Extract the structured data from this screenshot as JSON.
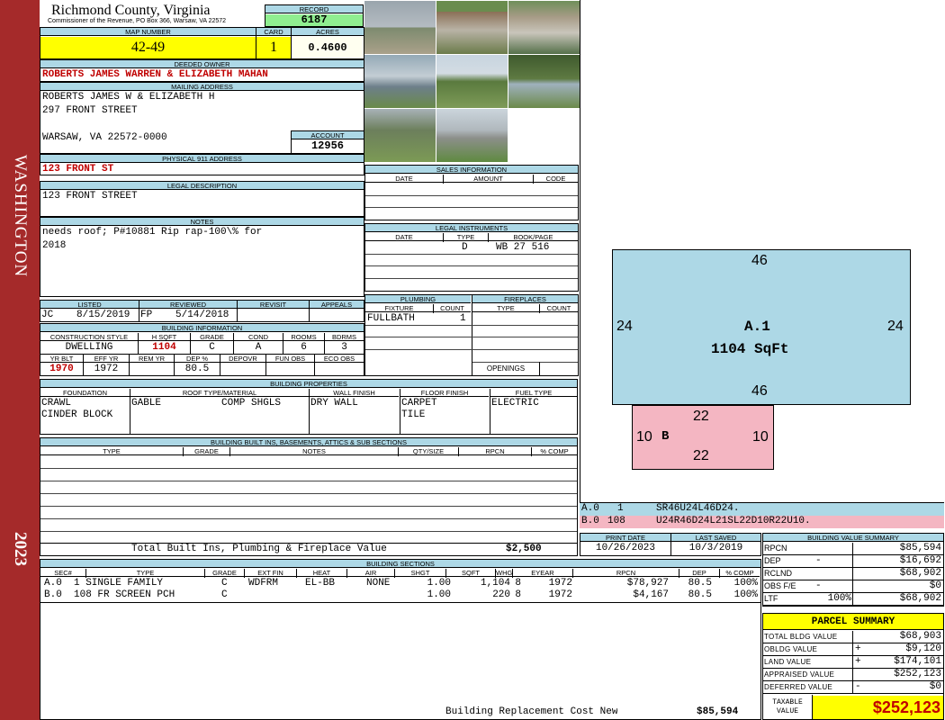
{
  "sidebar": {
    "district": "WASHINGTON",
    "year": "2023",
    "color": "#a52a2a"
  },
  "header": {
    "county": "Richmond County, Virginia",
    "commissioner": "Commissioner of the Revenue, PO Box 366, Warsaw, VA 22572"
  },
  "record": {
    "label": "RECORD",
    "value": "6187"
  },
  "map_number": {
    "label": "MAP NUMBER",
    "value": "42-49"
  },
  "card": {
    "label": "CARD",
    "value": "1"
  },
  "acres": {
    "label": "ACRES",
    "value": "0.4600"
  },
  "deeded_owner": {
    "label": "DEEDED OWNER",
    "value": "ROBERTS JAMES WARREN & ELIZABETH MAHAN"
  },
  "mailing": {
    "label": "MAILING ADDRESS",
    "line1": "ROBERTS JAMES W & ELIZABETH H",
    "line2": "297 FRONT STREET",
    "line3": "WARSAW, VA 22572-0000"
  },
  "account": {
    "label": "ACCOUNT",
    "value": "12956"
  },
  "physical": {
    "label": "PHYSICAL 911 ADDRESS",
    "value": "123 FRONT ST"
  },
  "legal": {
    "label": "LEGAL DESCRIPTION",
    "value": "123 FRONT STREET"
  },
  "notes": {
    "label": "NOTES",
    "line1": "needs roof; P#10881 Rip rap-100\\% for",
    "line2": "2018"
  },
  "sales": {
    "label": "SALES INFORMATION",
    "cols": [
      "DATE",
      "AMOUNT",
      "CODE"
    ]
  },
  "legal_instruments": {
    "label": "LEGAL INSTRUMENTS",
    "cols": [
      "DATE",
      "TYPE",
      "BOOK/PAGE"
    ],
    "row": {
      "type": "D",
      "book": "WB 27 516"
    }
  },
  "dates": {
    "listed_label": "LISTED",
    "reviewed_label": "REVIEWED",
    "revisit_label": "REVISIT",
    "appeals_label": "APPEALS",
    "listed_by": "JC",
    "listed": "8/15/2019",
    "reviewed_by": "FP",
    "reviewed": "5/14/2018"
  },
  "plumbing": {
    "label": "PLUMBING",
    "fixture_label": "FIXTURE",
    "count_label": "COUNT",
    "fixture": "FULLBATH",
    "count": "1"
  },
  "fireplaces": {
    "label": "FIREPLACES",
    "type_label": "TYPE",
    "count_label": "COUNT",
    "openings_label": "OPENINGS"
  },
  "building_info": {
    "label": "BUILDING INFORMATION",
    "cols1": [
      "CONSTRUCTION STYLE",
      "H SQFT",
      "GRADE",
      "COND",
      "ROOMS",
      "BDRMS"
    ],
    "vals1": [
      "DWELLING",
      "1104",
      "C",
      "A",
      "6",
      "3"
    ],
    "cols2": [
      "YR BLT",
      "EFF YR",
      "REM YR",
      "DEP %",
      "DEPOVR",
      "FUN OBS",
      "ECO OBS"
    ],
    "vals2": [
      "1970",
      "1972",
      "",
      "80.5",
      "",
      "",
      ""
    ]
  },
  "building_props": {
    "label": "BUILDING PROPERTIES",
    "cols": [
      "FOUNDATION",
      "ROOF TYPE/MATERIAL",
      "WALL FINISH",
      "FLOOR FINISH",
      "FUEL TYPE"
    ],
    "foundation": [
      "CRAWL",
      "CINDER BLOCK"
    ],
    "roof_type": "GABLE",
    "roof_material": "COMP SHGLS",
    "wall": "DRY WALL",
    "floor": [
      "CARPET",
      "TILE"
    ],
    "fuel": "ELECTRIC"
  },
  "built_ins": {
    "label": "BUILDING BUILT INS, BASEMENTS, ATTICS & SUB SECTIONS",
    "cols": [
      "TYPE",
      "GRADE",
      "NOTES",
      "QTY/SIZE",
      "RPCN",
      "% COMP"
    ],
    "total_label": "Total Built Ins, Plumbing & Fireplace Value",
    "total": "$2,500"
  },
  "print": {
    "print_label": "PRINT DATE",
    "saved_label": "LAST SAVED",
    "print_date": "10/26/2023",
    "last_saved": "10/3/2019"
  },
  "sketch": {
    "areaA": {
      "label": "A.1",
      "sqft": "1104 SqFt",
      "top": "46",
      "bottom": "46",
      "left": "24",
      "right": "24",
      "color": "#add8e6"
    },
    "areaB": {
      "label": "B",
      "top": "22",
      "bottom": "22",
      "left": "10",
      "right": "10",
      "color": "#f4b6c2"
    },
    "legendA": {
      "code": "A.0",
      "num": "1",
      "path": "SR46U24L46D24."
    },
    "legendB": {
      "code": "B.0",
      "num": "108",
      "path": "U24R46D24L21SL22D10R22U10."
    }
  },
  "sections": {
    "label": "BUILDING SECTIONS",
    "cols": [
      "SEC#",
      "TYPE",
      "GRADE",
      "EXT FIN",
      "HEAT",
      "AIR",
      "SHGT",
      "SQFT",
      "WHGT",
      "EYEAR",
      "RPCN",
      "DEP",
      "% COMP"
    ],
    "rows": [
      [
        "A.0",
        "1 SINGLE FAMILY",
        "C",
        "WDFRM",
        "EL-BB",
        "NONE",
        "1.00",
        "1,104",
        "8",
        "1972",
        "$78,927",
        "80.5",
        "100%"
      ],
      [
        "B.0",
        "108 FR SCREEN PCH",
        "C",
        "",
        "",
        "",
        "1.00",
        "220",
        "8",
        "1972",
        "$4,167",
        "80.5",
        "100%"
      ]
    ],
    "replacement_label": "Building Replacement Cost New",
    "replacement": "$85,594"
  },
  "value_summary": {
    "label": "BUILDING VALUE SUMMARY",
    "rows": [
      {
        "label": "RPCN",
        "sign": "",
        "value": "$85,594"
      },
      {
        "label": "DEP",
        "sign": "-",
        "value": "$16,692"
      },
      {
        "label": "RCLND",
        "sign": "",
        "value": "$68,902"
      },
      {
        "label": "OBS F/E",
        "sign": "-",
        "value": "$0"
      },
      {
        "label": "LTF",
        "sign": "100%",
        "value": "$68,902"
      }
    ]
  },
  "parcel": {
    "label": "PARCEL SUMMARY",
    "rows": [
      {
        "label": "TOTAL BLDG VALUE",
        "sign": "",
        "value": "$68,903"
      },
      {
        "label": "OBLDG VALUE",
        "sign": "+",
        "value": "$9,120"
      },
      {
        "label": "LAND VALUE",
        "sign": "+",
        "value": "$174,101"
      },
      {
        "label": "APPRAISED VALUE",
        "sign": "",
        "value": "$252,123"
      },
      {
        "label": "DEFERRED VALUE",
        "sign": "-",
        "value": "$0"
      }
    ],
    "taxable_label1": "TAXABLE",
    "taxable_label2": "VALUE",
    "taxable": "$252,123",
    "accent": "#ffff00",
    "taxable_color": "#c00000"
  }
}
